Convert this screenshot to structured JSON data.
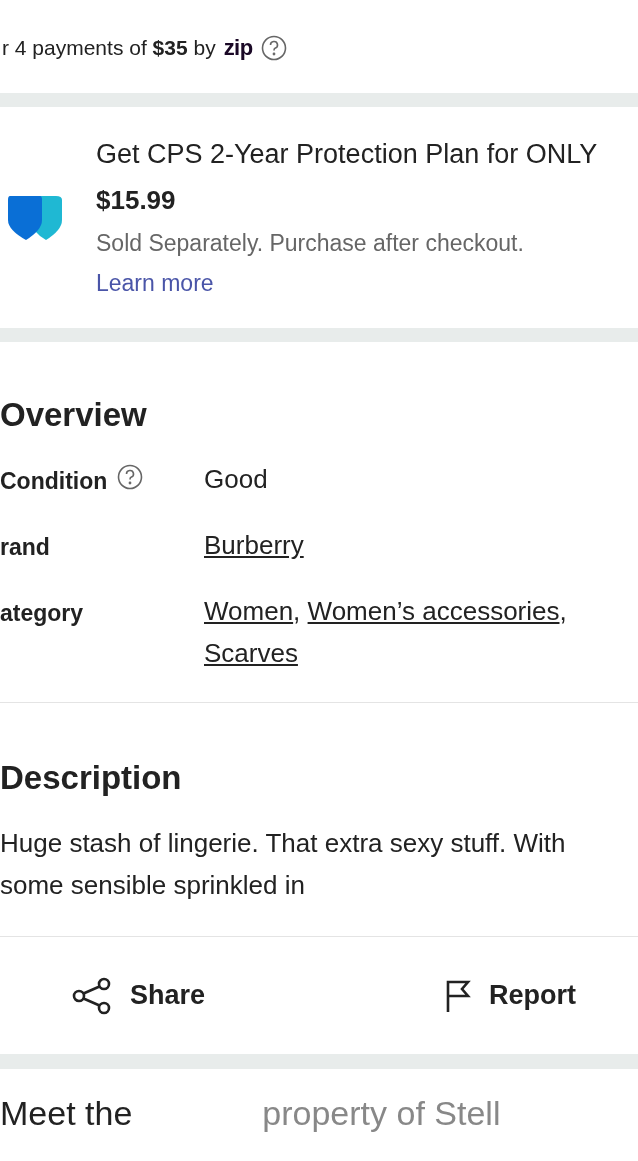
{
  "payment": {
    "prefix": "r 4 payments of",
    "amount": "$35",
    "by": "by",
    "zip_logo": "zip"
  },
  "protection": {
    "title": "Get CPS 2-Year Protection Plan for ONLY",
    "price": "$15.99",
    "note": "Sold Separately. Purchase after checkout.",
    "link": "Learn more"
  },
  "overview": {
    "title": "Overview",
    "rows": [
      {
        "label": "Condition",
        "help": true,
        "values": [
          {
            "text": "Good",
            "link": false
          }
        ]
      },
      {
        "label": "rand",
        "help": false,
        "values": [
          {
            "text": "Burberry",
            "link": true
          }
        ]
      },
      {
        "label": "ategory",
        "help": false,
        "separator": ",",
        "values": [
          {
            "text": "Women",
            "link": true
          },
          {
            "text": "Women’s accessories",
            "link": true
          },
          {
            "text": "Scarves",
            "link": true
          }
        ]
      }
    ]
  },
  "description": {
    "title": "Description",
    "text": "Huge stash of lingerie. That extra sexy stuff. With some sensible sprinkled in"
  },
  "actions": [
    {
      "kind": "share",
      "label": "Share"
    },
    {
      "kind": "report",
      "label": "Report"
    }
  ],
  "footer": {
    "left": "Meet the",
    "right": "property of Stell"
  }
}
